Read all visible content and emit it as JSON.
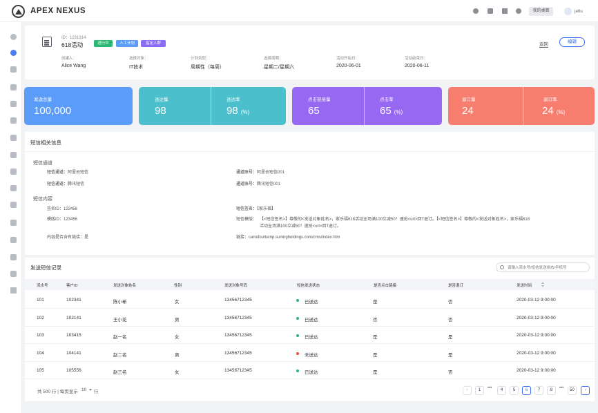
{
  "header": {
    "brand": "APEX NEXUS",
    "workspace_btn": "我的桌面",
    "username": "jetlu"
  },
  "task": {
    "id_label": "ID：1231314",
    "name": "618活动",
    "tags": [
      {
        "label": "进行中",
        "color": "#2bb673"
      },
      {
        "label": "人工计划",
        "color": "#5b9cf6"
      },
      {
        "label": "指定人群",
        "color": "#8b6df5"
      }
    ],
    "back": "返回",
    "edit": "编辑",
    "meta": [
      {
        "label": "创建人：",
        "value": "Alice Wang"
      },
      {
        "label": "选择对象：",
        "value": "IT技术"
      },
      {
        "label": "计划类型：",
        "value": "周期性（每周）"
      },
      {
        "label": "选择周期：",
        "value": "星期二/星期六"
      },
      {
        "label": "活动开始日：",
        "value": "2020-06-01"
      },
      {
        "label": "活动结束日：",
        "value": "2020-06-11"
      }
    ]
  },
  "stats": {
    "sent": {
      "label": "发送总量",
      "value": "100,000",
      "color": "#5b9cf8"
    },
    "delivered": {
      "label": "送达量",
      "value": "98",
      "color": "#4bbfcc"
    },
    "delivery_rate": {
      "label": "送达率",
      "value": "98",
      "unit": "(%)"
    },
    "clicks": {
      "label": "点击链接量",
      "value": "65",
      "color": "#9768f2"
    },
    "click_rate": {
      "label": "点击率",
      "value": "65",
      "unit": "(%)"
    },
    "unsub": {
      "label": "退订量",
      "value": "24",
      "color": "#f77d6f"
    },
    "unsub_rate": {
      "label": "退订率",
      "value": "24",
      "unit": "(%)"
    }
  },
  "sms_info": {
    "title": "短信相关信息",
    "channel_title": "短信通道",
    "channel1": {
      "k": "短信通道：",
      "v": "阿里云短信"
    },
    "channel2": {
      "k": "短信通道：",
      "v": "腾讯短信"
    },
    "account1": {
      "k": "通道账号：",
      "v": "阿里云短信001"
    },
    "account2": {
      "k": "通道账号：",
      "v": "腾讯短信001"
    },
    "content_title": "短信内容",
    "sign_id": "签名ID：123456",
    "template_id": "模版ID：123456",
    "has_link": "内容是否含有链接：是",
    "sign": {
      "k": "短信签名：",
      "v": "【家乐福】"
    },
    "template_k": "短信模版：",
    "template_line1": "【<短信签名>】尊敬的<发送对象姓名>，家乐福618活动全场满100立减50！速抢<url>回T退订。【<短信签名>】尊敬的<发送对象姓名>，家乐福618",
    "template_line2": "活动全场满100立减50！速抢<url>回T退订。",
    "link": "链接：carrefourtemp.suningholdings.com/cms/index.htm"
  },
  "records": {
    "title": "发送短信记录",
    "search_placeholder": "请输入流水号/短信发送状态/手机号",
    "columns": [
      "流水号",
      "客户ID",
      "发送对象姓名",
      "性别",
      "发送对象号码",
      "短信发送状态",
      "是否点击链接",
      "是否退订",
      "发送时间"
    ],
    "rows": [
      {
        "serial": "101",
        "cid": "102341",
        "name": "陈小希",
        "gender": "女",
        "phone": "13456712345",
        "status": "已送达",
        "status_color": "#2bb673",
        "clicked": "是",
        "unsub": "否",
        "time": "2020-03-12 9:00:00"
      },
      {
        "serial": "102",
        "cid": "102141",
        "name": "王小花",
        "gender": "男",
        "phone": "13456712345",
        "status": "已送达",
        "status_color": "#2bb673",
        "clicked": "否",
        "unsub": "否",
        "time": "2020-03-12 9:00:00"
      },
      {
        "serial": "103",
        "cid": "103415",
        "name": "赵一名",
        "gender": "女",
        "phone": "13456712345",
        "status": "已送达",
        "status_color": "#2bb673",
        "clicked": "是",
        "unsub": "是",
        "time": "2020-03-12 9:00:00"
      },
      {
        "serial": "104",
        "cid": "104141",
        "name": "赵二名",
        "gender": "男",
        "phone": "13456712345",
        "status": "未送达",
        "status_color": "#f0483e",
        "clicked": "是",
        "unsub": "是",
        "time": "2020-03-12 9:00:00"
      },
      {
        "serial": "105",
        "cid": "105556",
        "name": "赵三名",
        "gender": "女",
        "phone": "13456712345",
        "status": "已送达",
        "status_color": "#2bb673",
        "clicked": "是",
        "unsub": "否",
        "time": "2020-03-12 9:00:00"
      }
    ],
    "pagination": {
      "total": "共 500 行 | 每页显示",
      "page_size": "10",
      "unit": "行",
      "prev": "‹",
      "next": "›",
      "ellipsis": "•••",
      "pages": [
        "1",
        "4",
        "5",
        "6",
        "7",
        "8",
        "50"
      ],
      "current": "6"
    }
  }
}
